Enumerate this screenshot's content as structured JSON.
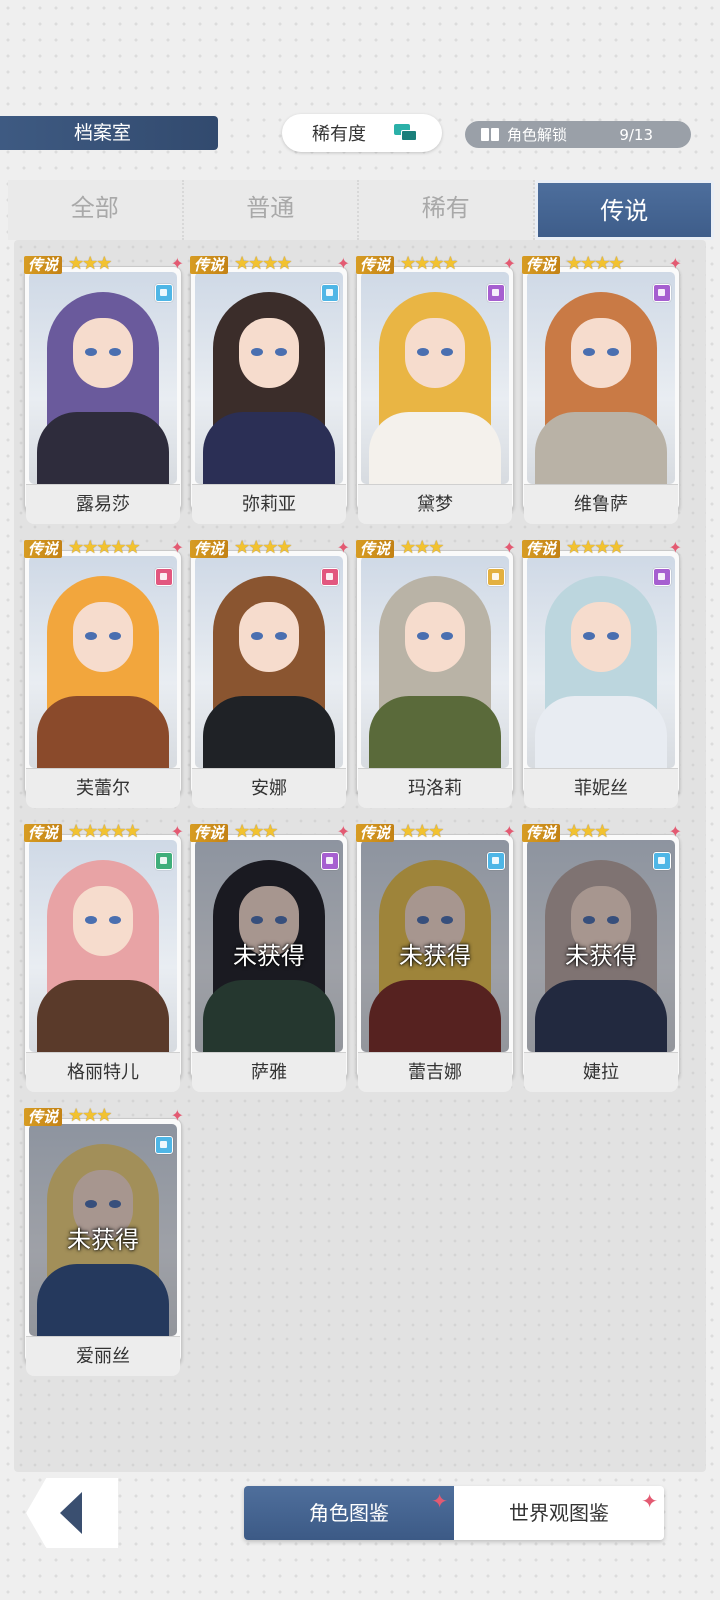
{
  "header": {
    "title": "档案室",
    "sort_label": "稀有度",
    "unlock_label": "角色解锁",
    "unlock_count": "9/13"
  },
  "tabs": [
    {
      "label": "全部"
    },
    {
      "label": "普通"
    },
    {
      "label": "稀有"
    },
    {
      "label": "传说"
    }
  ],
  "active_tab": "传说",
  "cards": [
    {
      "name": "露易莎",
      "rarity": "传说",
      "stars": "★★★",
      "element": "blue",
      "locked": false,
      "hair": "#6a5a9c",
      "outfit": "#2e2c3c"
    },
    {
      "name": "弥莉亚",
      "rarity": "传说",
      "stars": "★★★★",
      "element": "blue",
      "locked": false,
      "hair": "#3b2d2a",
      "outfit": "#2b2f55"
    },
    {
      "name": "黛梦",
      "rarity": "传说",
      "stars": "★★★★",
      "element": "purple",
      "locked": false,
      "hair": "#e9b544",
      "outfit": "#f4f1ec"
    },
    {
      "name": "维鲁萨",
      "rarity": "传说",
      "stars": "★★★★",
      "element": "purple",
      "locked": false,
      "hair": "#c97a45",
      "outfit": "#b9b2a6"
    },
    {
      "name": "芙蕾尔",
      "rarity": "传说",
      "stars": "★★★★★",
      "element": "pink",
      "locked": false,
      "hair": "#f2a63d",
      "outfit": "#8a4a2b"
    },
    {
      "name": "安娜",
      "rarity": "传说",
      "stars": "★★★★",
      "element": "pink",
      "locked": false,
      "hair": "#8a5530",
      "outfit": "#1f2226"
    },
    {
      "name": "玛洛莉",
      "rarity": "传说",
      "stars": "★★★",
      "element": "gold",
      "locked": false,
      "hair": "#b9b3a6",
      "outfit": "#5a6a3a"
    },
    {
      "name": "菲妮丝",
      "rarity": "传说",
      "stars": "★★★★",
      "element": "purple",
      "locked": false,
      "hair": "#bcd6de",
      "outfit": "#e8ecf2"
    },
    {
      "name": "格丽特儿",
      "rarity": "传说",
      "stars": "★★★★★",
      "element": "green",
      "locked": false,
      "hair": "#e8a3a5",
      "outfit": "#5a3a2a"
    },
    {
      "name": "萨雅",
      "rarity": "传说",
      "stars": "★★★",
      "element": "purple",
      "locked": true,
      "hair": "#1e1e24",
      "outfit": "#2f4a3a"
    },
    {
      "name": "蕾吉娜",
      "rarity": "传说",
      "stars": "★★★",
      "element": "blue",
      "locked": true,
      "hair": "#e8c04a",
      "outfit": "#7a2a22"
    },
    {
      "name": "婕拉",
      "rarity": "传说",
      "stars": "★★★",
      "element": "blue",
      "locked": true,
      "hair": "#b8a7a0",
      "outfit": "#2a3552"
    },
    {
      "name": "爱丽丝",
      "rarity": "传说",
      "stars": "★★★",
      "element": "blue",
      "locked": true,
      "hair": "#efd27a",
      "outfit": "#2e4d80"
    }
  ],
  "locked_text": "未获得",
  "bottom_nav": {
    "back_icon": "back-arrow-icon",
    "left": "角色图鉴",
    "right": "世界观图鉴"
  },
  "colors": {
    "accent": "#3e5d8a",
    "rarity_tag": "#d79c23",
    "star": "#f2c230",
    "blue": "#4fb6e6",
    "purple": "#a65fd0",
    "pink": "#e2577f",
    "gold": "#e3b040",
    "green": "#3fae7a"
  }
}
